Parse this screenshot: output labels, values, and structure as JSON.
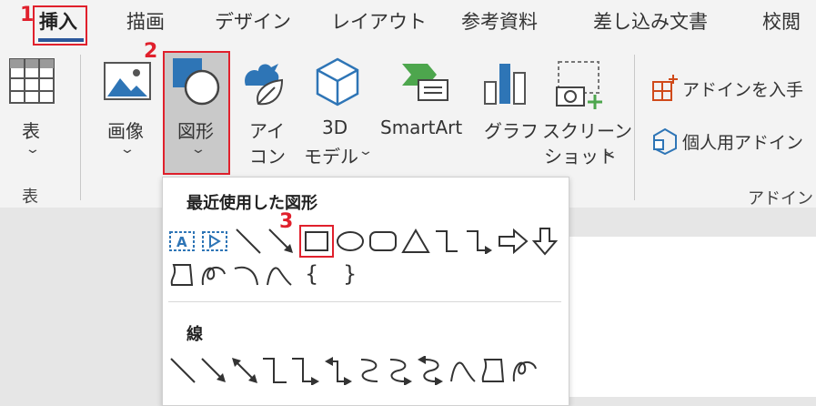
{
  "callouts": [
    "1",
    "2",
    "3"
  ],
  "tabs": [
    "挿入",
    "描画",
    "デザイン",
    "レイアウト",
    "参考資料",
    "差し込み文書",
    "校閲"
  ],
  "ribbon": {
    "table": {
      "label": "表"
    },
    "picture": {
      "label": "画像"
    },
    "shapes": {
      "label": "図形"
    },
    "icons": {
      "label1": "アイ",
      "label2": "コン"
    },
    "model3d": {
      "label1": "3D",
      "label2": "モデル"
    },
    "smartart": {
      "label": "SmartArt"
    },
    "chart": {
      "label": "グラフ"
    },
    "screenshot": {
      "label1": "スクリーン",
      "label2": "ショット"
    },
    "get_addins": {
      "label": "アドインを入手"
    },
    "my_addins": {
      "label": "個人用アドイン"
    },
    "groups": {
      "table": "表",
      "addins": "アドイン"
    }
  },
  "dropdown": {
    "recent_title": "最近使用した図形",
    "lines_title": "線",
    "brace_left": "{",
    "brace_right": "}"
  },
  "colors": {
    "accent": "#2b579a",
    "highlight": "#e0202c",
    "icon_blue": "#2e75b6",
    "icon_green": "#4da64d"
  }
}
